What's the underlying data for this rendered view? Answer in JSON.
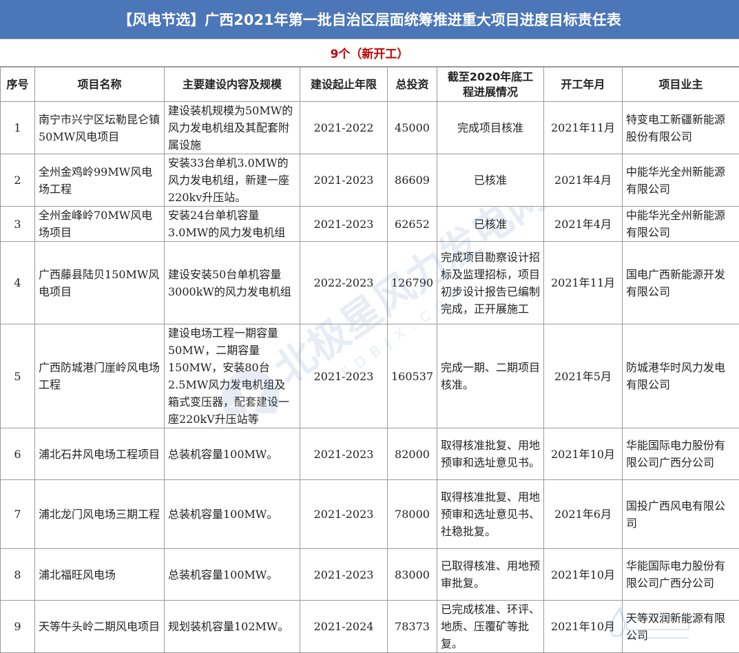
{
  "title": "【风电节选】广西2021年第一批自治区层面统筹推进重大项目进度目标责任表",
  "subtitle": "9个（新开工）",
  "headers": [
    "序号",
    "项目名称",
    "主要建设内容及规模",
    "建设起止年限",
    "总投资",
    "截至2020年底工程进展情况",
    "开工年月",
    "项目业主"
  ],
  "rows": [
    {
      "no": "1",
      "name": "南宁市兴宁区坛勒昆仑镇50MW风电项目",
      "content": "建设装机规模为50MW的风力发电机组及其配套附属设施",
      "years": "2021-2022",
      "investment": "45000",
      "progress": "完成项目核准",
      "start": "2021年11月",
      "owner": "特变电工新疆新能源股份有限公司"
    },
    {
      "no": "2",
      "name": "全州金鸡岭99MW风电场工程",
      "content": "安装33台单机3.0MW的风力发电机组，新建一座220kv升压站。",
      "years": "2021-2023",
      "investment": "86609",
      "progress": "已核准",
      "start": "2021年4月",
      "owner": "中能华光全州新能源有限公司"
    },
    {
      "no": "3",
      "name": "全州金峰岭70MW风电场项目",
      "content": "安装24台单机容量3.0MW的风力发电机组",
      "years": "2021-2023",
      "investment": "62652",
      "progress": "已核准",
      "start": "2021年4月",
      "owner": "中能华光全州新能源有限公司"
    },
    {
      "no": "4",
      "name": "广西藤县陆贝150MW风电项目",
      "content": "建设安装50台单机容量3000kW的风力发电机组",
      "years": "2022-2023",
      "investment": "126790",
      "progress": "完成项目勘察设计招标及监理招标，项目初步设计报告已编制完成，正开展施工",
      "start": "2021年11月",
      "owner": "国电广西新能源开发有限公司"
    },
    {
      "no": "5",
      "name": "广西防城港门崖岭风电场工程",
      "content": "建设电场工程一期容量50MW，二期容量150MW，安装80台2.5MW风力发电机组及箱式变压器，配套建设一座220kV升压站等",
      "years": "2021-2023",
      "investment": "160537",
      "progress": "完成一期、二期项目核准。",
      "start": "2021年5月",
      "owner": "防城港华时风力发电有限公司"
    },
    {
      "no": "6",
      "name": "浦北石井风电场工程项目",
      "content": "总装机容量100MW。",
      "years": "2021-2023",
      "investment": "82000",
      "progress": "取得核准批复、用地预审和选址意见书。",
      "start": "2021年10月",
      "owner": "华能国际电力股份有限公司广西分公司"
    },
    {
      "no": "7",
      "name": "浦北龙门风电场三期工程",
      "content": "总装机容量100MW。",
      "years": "2021-2023",
      "investment": "78000",
      "progress": "取得核准批复、用地预审和选址意见书、社稳批复。",
      "start": "2021年6月",
      "owner": "国投广西风电有限公司"
    },
    {
      "no": "8",
      "name": "浦北福旺风电场",
      "content": "总装机容量100MW。",
      "years": "2021-2023",
      "investment": "83000",
      "progress": "已取得核准、用地预审批复。",
      "start": "2021年10月",
      "owner": "华能国际电力股份有限公司广西分公司"
    },
    {
      "no": "9",
      "name": "天等牛头岭二期风电项目",
      "content": "规划装机容量102MW。",
      "years": "2021-2024",
      "investment": "78373",
      "progress": "已完成核准、环评、地质、压覆矿等批复。",
      "start": "2021年10月",
      "owner": "天等双润新能源有限公司"
    }
  ],
  "watermark": {
    "text": "北极星风力发电网",
    "sub_text": "FDBJX.COM",
    "icon": "polaris-star-logo",
    "corner_logo": "energy-network-logo",
    "color": "#4b76b8"
  },
  "colors": {
    "title_bg": "#4b76b8",
    "title_fg": "#ffffff",
    "subtitle_fg": "#c00000",
    "grid": "#9a9a9a"
  }
}
